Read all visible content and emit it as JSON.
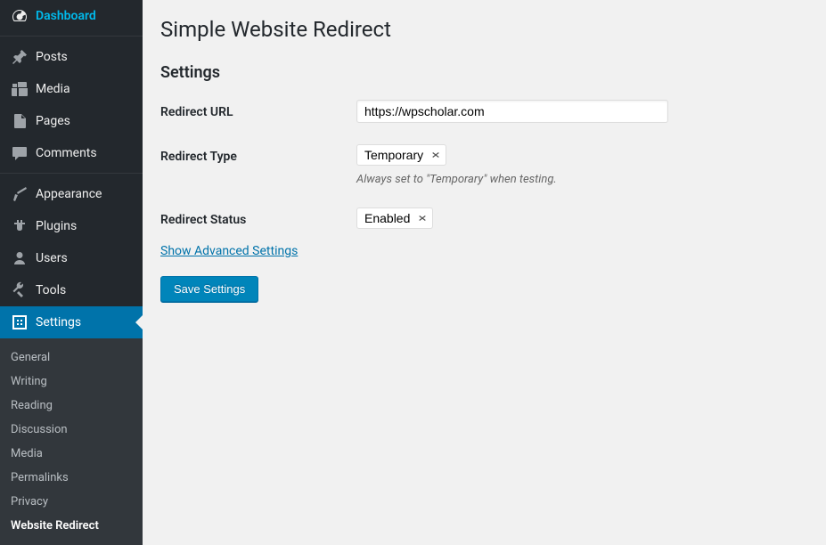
{
  "sidebar": {
    "items": [
      {
        "label": "Dashboard",
        "icon": "dashboard"
      },
      {
        "label": "Posts",
        "icon": "pin"
      },
      {
        "label": "Media",
        "icon": "media"
      },
      {
        "label": "Pages",
        "icon": "pages"
      },
      {
        "label": "Comments",
        "icon": "comments"
      },
      {
        "label": "Appearance",
        "icon": "appearance"
      },
      {
        "label": "Plugins",
        "icon": "plugins"
      },
      {
        "label": "Users",
        "icon": "users"
      },
      {
        "label": "Tools",
        "icon": "tools"
      },
      {
        "label": "Settings",
        "icon": "settings"
      }
    ],
    "submenu": [
      {
        "label": "General"
      },
      {
        "label": "Writing"
      },
      {
        "label": "Reading"
      },
      {
        "label": "Discussion"
      },
      {
        "label": "Media"
      },
      {
        "label": "Permalinks"
      },
      {
        "label": "Privacy"
      },
      {
        "label": "Website Redirect"
      }
    ]
  },
  "page": {
    "title": "Simple Website Redirect",
    "section_title": "Settings"
  },
  "form": {
    "redirect_url": {
      "label": "Redirect URL",
      "value": "https://wpscholar.com"
    },
    "redirect_type": {
      "label": "Redirect Type",
      "value": "Temporary",
      "description": "Always set to \"Temporary\" when testing."
    },
    "redirect_status": {
      "label": "Redirect Status",
      "value": "Enabled"
    },
    "advanced_link": "Show Advanced Settings",
    "submit_label": "Save Settings"
  }
}
